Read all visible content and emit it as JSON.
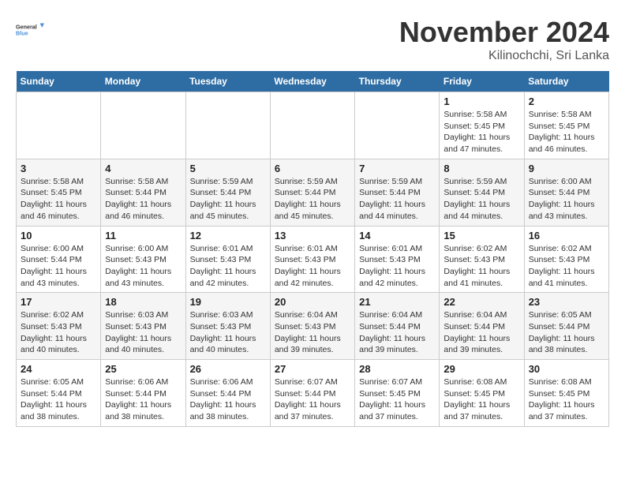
{
  "logo": {
    "line1": "General",
    "line2": "Blue"
  },
  "title": "November 2024",
  "subtitle": "Kilinochchi, Sri Lanka",
  "weekdays": [
    "Sunday",
    "Monday",
    "Tuesday",
    "Wednesday",
    "Thursday",
    "Friday",
    "Saturday"
  ],
  "weeks": [
    [
      {
        "day": "",
        "info": ""
      },
      {
        "day": "",
        "info": ""
      },
      {
        "day": "",
        "info": ""
      },
      {
        "day": "",
        "info": ""
      },
      {
        "day": "",
        "info": ""
      },
      {
        "day": "1",
        "info": "Sunrise: 5:58 AM\nSunset: 5:45 PM\nDaylight: 11 hours\nand 47 minutes."
      },
      {
        "day": "2",
        "info": "Sunrise: 5:58 AM\nSunset: 5:45 PM\nDaylight: 11 hours\nand 46 minutes."
      }
    ],
    [
      {
        "day": "3",
        "info": "Sunrise: 5:58 AM\nSunset: 5:45 PM\nDaylight: 11 hours\nand 46 minutes."
      },
      {
        "day": "4",
        "info": "Sunrise: 5:58 AM\nSunset: 5:44 PM\nDaylight: 11 hours\nand 46 minutes."
      },
      {
        "day": "5",
        "info": "Sunrise: 5:59 AM\nSunset: 5:44 PM\nDaylight: 11 hours\nand 45 minutes."
      },
      {
        "day": "6",
        "info": "Sunrise: 5:59 AM\nSunset: 5:44 PM\nDaylight: 11 hours\nand 45 minutes."
      },
      {
        "day": "7",
        "info": "Sunrise: 5:59 AM\nSunset: 5:44 PM\nDaylight: 11 hours\nand 44 minutes."
      },
      {
        "day": "8",
        "info": "Sunrise: 5:59 AM\nSunset: 5:44 PM\nDaylight: 11 hours\nand 44 minutes."
      },
      {
        "day": "9",
        "info": "Sunrise: 6:00 AM\nSunset: 5:44 PM\nDaylight: 11 hours\nand 43 minutes."
      }
    ],
    [
      {
        "day": "10",
        "info": "Sunrise: 6:00 AM\nSunset: 5:44 PM\nDaylight: 11 hours\nand 43 minutes."
      },
      {
        "day": "11",
        "info": "Sunrise: 6:00 AM\nSunset: 5:43 PM\nDaylight: 11 hours\nand 43 minutes."
      },
      {
        "day": "12",
        "info": "Sunrise: 6:01 AM\nSunset: 5:43 PM\nDaylight: 11 hours\nand 42 minutes."
      },
      {
        "day": "13",
        "info": "Sunrise: 6:01 AM\nSunset: 5:43 PM\nDaylight: 11 hours\nand 42 minutes."
      },
      {
        "day": "14",
        "info": "Sunrise: 6:01 AM\nSunset: 5:43 PM\nDaylight: 11 hours\nand 42 minutes."
      },
      {
        "day": "15",
        "info": "Sunrise: 6:02 AM\nSunset: 5:43 PM\nDaylight: 11 hours\nand 41 minutes."
      },
      {
        "day": "16",
        "info": "Sunrise: 6:02 AM\nSunset: 5:43 PM\nDaylight: 11 hours\nand 41 minutes."
      }
    ],
    [
      {
        "day": "17",
        "info": "Sunrise: 6:02 AM\nSunset: 5:43 PM\nDaylight: 11 hours\nand 40 minutes."
      },
      {
        "day": "18",
        "info": "Sunrise: 6:03 AM\nSunset: 5:43 PM\nDaylight: 11 hours\nand 40 minutes."
      },
      {
        "day": "19",
        "info": "Sunrise: 6:03 AM\nSunset: 5:43 PM\nDaylight: 11 hours\nand 40 minutes."
      },
      {
        "day": "20",
        "info": "Sunrise: 6:04 AM\nSunset: 5:43 PM\nDaylight: 11 hours\nand 39 minutes."
      },
      {
        "day": "21",
        "info": "Sunrise: 6:04 AM\nSunset: 5:44 PM\nDaylight: 11 hours\nand 39 minutes."
      },
      {
        "day": "22",
        "info": "Sunrise: 6:04 AM\nSunset: 5:44 PM\nDaylight: 11 hours\nand 39 minutes."
      },
      {
        "day": "23",
        "info": "Sunrise: 6:05 AM\nSunset: 5:44 PM\nDaylight: 11 hours\nand 38 minutes."
      }
    ],
    [
      {
        "day": "24",
        "info": "Sunrise: 6:05 AM\nSunset: 5:44 PM\nDaylight: 11 hours\nand 38 minutes."
      },
      {
        "day": "25",
        "info": "Sunrise: 6:06 AM\nSunset: 5:44 PM\nDaylight: 11 hours\nand 38 minutes."
      },
      {
        "day": "26",
        "info": "Sunrise: 6:06 AM\nSunset: 5:44 PM\nDaylight: 11 hours\nand 38 minutes."
      },
      {
        "day": "27",
        "info": "Sunrise: 6:07 AM\nSunset: 5:44 PM\nDaylight: 11 hours\nand 37 minutes."
      },
      {
        "day": "28",
        "info": "Sunrise: 6:07 AM\nSunset: 5:45 PM\nDaylight: 11 hours\nand 37 minutes."
      },
      {
        "day": "29",
        "info": "Sunrise: 6:08 AM\nSunset: 5:45 PM\nDaylight: 11 hours\nand 37 minutes."
      },
      {
        "day": "30",
        "info": "Sunrise: 6:08 AM\nSunset: 5:45 PM\nDaylight: 11 hours\nand 37 minutes."
      }
    ]
  ]
}
